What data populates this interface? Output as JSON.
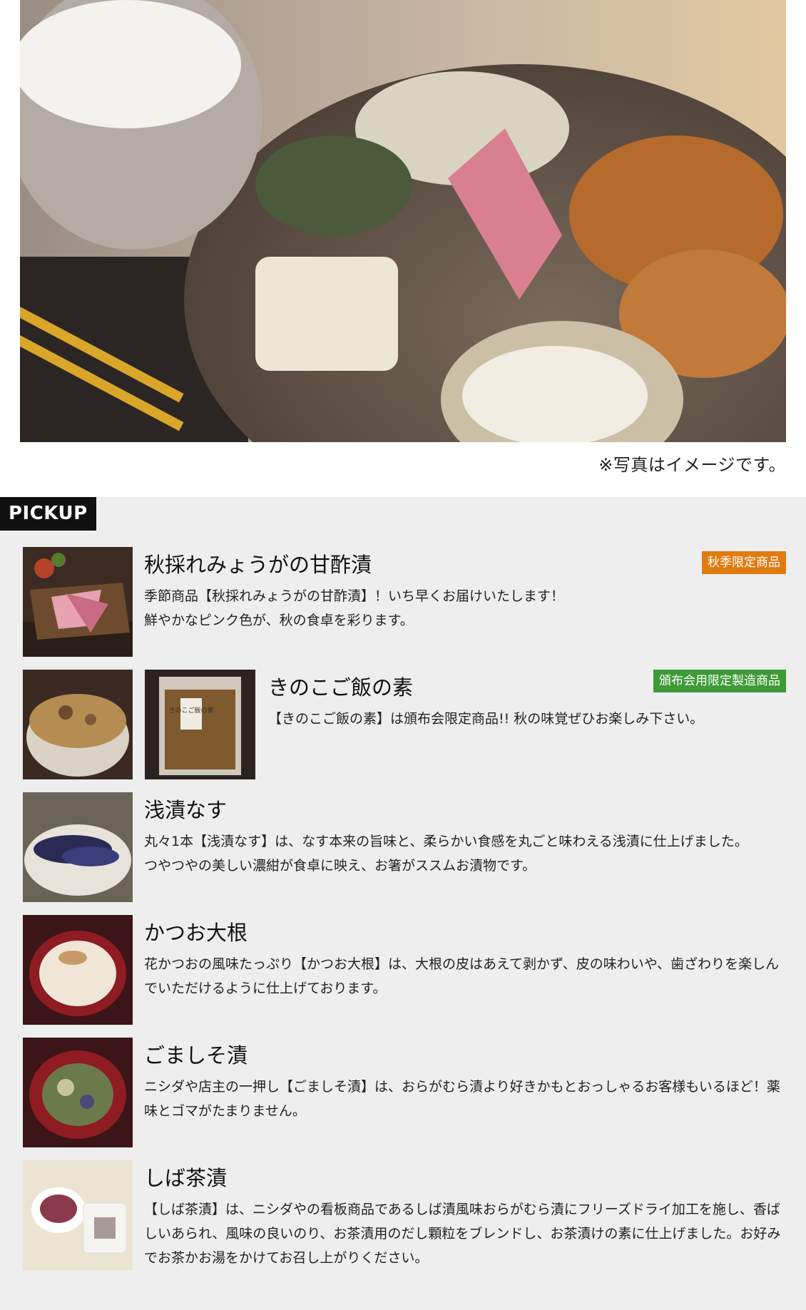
{
  "hero": {
    "caption": "※写真はイメージです。"
  },
  "pickup": {
    "label": "PICKUP",
    "items": [
      {
        "title": "秋採れみょうがの甘酢漬",
        "badge": "秋季限定商品",
        "badge_color": "#e07b10",
        "description": "季節商品【秋採れみょうがの甘酢漬】！いち早くお届けいたします！\n鮮やかなピンク色が、秋の食卓を彩ります。"
      },
      {
        "title": "きのこご飯の素",
        "badge": "頒布会用限定製造商品",
        "badge_color": "#3f9a36",
        "description": "【きのこご飯の素】は頒布会限定商品!! 秋の味覚ぜひお楽しみ下さい。",
        "package_text": "きのこご飯の素"
      },
      {
        "title": "浅漬なす",
        "description": "丸々1本【浅漬なす】は、なす本来の旨味と、柔らかい食感を丸ごと味わえる浅漬に仕上げました。\nつやつやの美しい濃紺が食卓に映え、お箸がススムお漬物です。"
      },
      {
        "title": "かつお大根",
        "description": "花かつおの風味たっぷり【かつお大根】は、大根の皮はあえて剥かず、皮の味わいや、歯ざわりを楽しんでいただけるように仕上げております。"
      },
      {
        "title": "ごましそ漬",
        "description": "ニシダや店主の一押し【ごましそ漬】は、おらがむら漬より好きかもとおっしゃるお客様もいるほど！薬味とゴマがたまりません。"
      },
      {
        "title": "しば茶漬",
        "description": "【しば茶漬】は、ニシダやの看板商品であるしば漬風味おらがむら漬にフリーズドライ加工を施し、香ばしいあられ、風味の良いのり、お茶漬用のだし顆粒をブレンドし、お茶漬けの素に仕上げました。お好みでお茶かお湯をかけてお召し上がりください。"
      }
    ]
  },
  "colors": {
    "section_bg": "#eeeeee",
    "label_bg": "#111111"
  }
}
